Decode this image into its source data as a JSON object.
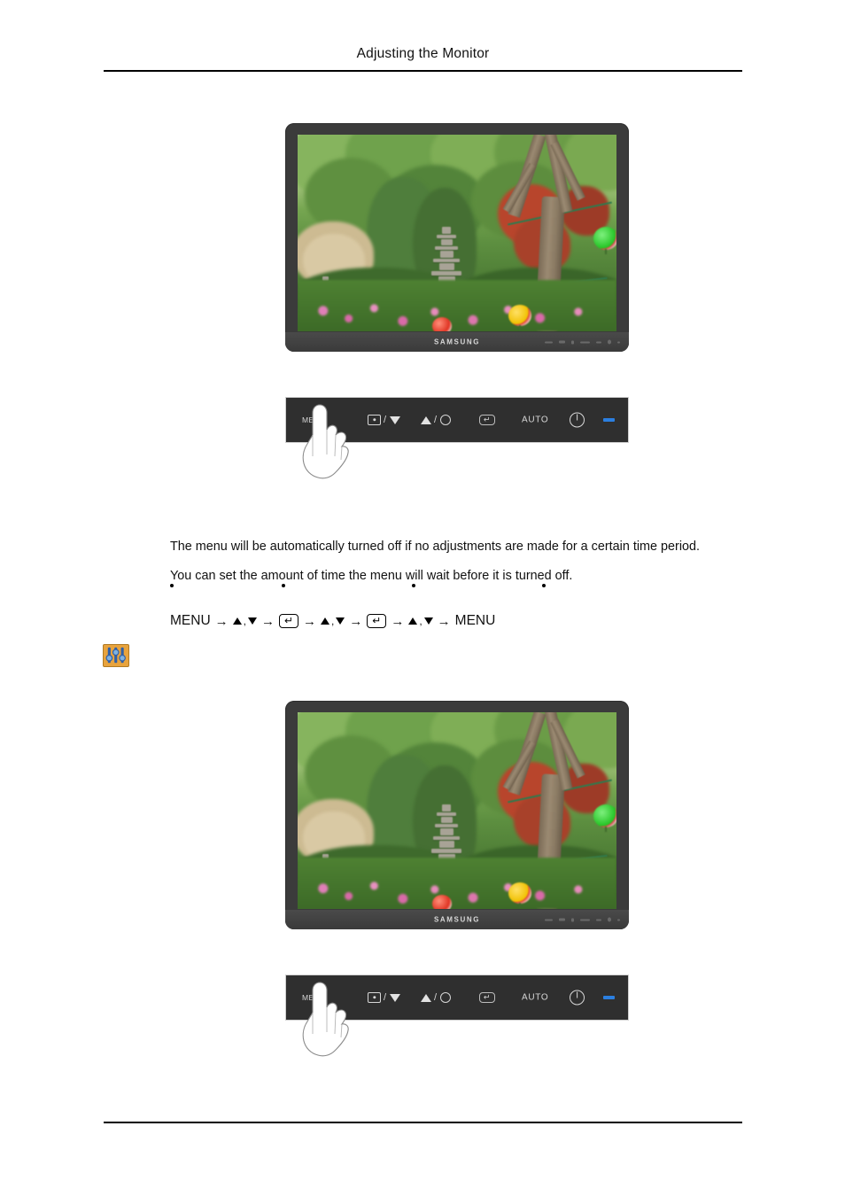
{
  "header": {
    "title": "Adjusting the Monitor"
  },
  "body": {
    "paragraph_1": "The menu will be automatically turned off if no adjustments are made for a certain time period.",
    "paragraph_2": "You can set the amount of time the menu will wait before it is turned off.",
    "bullets": [
      "",
      "",
      "",
      ""
    ]
  },
  "nav_sequence": {
    "start_label": "MENU",
    "end_label": "MENU",
    "arrow": "→",
    "comma": ",",
    "up_icon": "triangle-up-icon",
    "down_icon": "triangle-down-icon",
    "enter_icon": "enter-key-icon"
  },
  "adjust_icon": {
    "name": "sliders-adjust-icon",
    "background": "#e8a33d",
    "slider_color": "#2f5fa8"
  },
  "figures": [
    {
      "id": "figure-top",
      "monitor": {
        "brand": "SAMSUNG",
        "bezel_color": "#3b3b3b",
        "screen_caption": "garden scene with stone pagoda, trees and paper lanterns"
      },
      "control_panel": {
        "buttons": [
          {
            "name": "menu-button",
            "label": "MENU"
          },
          {
            "name": "source-down-button",
            "label": "/",
            "icons": [
              "source-icon",
              "triangle-down-icon"
            ]
          },
          {
            "name": "brightness-up-button",
            "label": "/",
            "icons": [
              "triangle-up-icon",
              "circle-icon"
            ]
          },
          {
            "name": "enter-button",
            "label": "",
            "icons": [
              "enter-key-icon"
            ]
          },
          {
            "name": "auto-button",
            "label": "AUTO"
          },
          {
            "name": "power-button",
            "label": "",
            "icons": [
              "power-icon"
            ]
          },
          {
            "name": "power-led",
            "label": "",
            "color": "#2b7fe0"
          }
        ],
        "hand_overlay": "hand-pressing-menu"
      }
    },
    {
      "id": "figure-bottom",
      "monitor": {
        "brand": "SAMSUNG",
        "bezel_color": "#3b3b3b",
        "screen_caption": "garden scene with stone pagoda, trees and paper lanterns"
      },
      "control_panel": {
        "buttons": [
          {
            "name": "menu-button",
            "label": "MENU"
          },
          {
            "name": "source-down-button",
            "label": "/",
            "icons": [
              "source-icon",
              "triangle-down-icon"
            ]
          },
          {
            "name": "brightness-up-button",
            "label": "/",
            "icons": [
              "triangle-up-icon",
              "circle-icon"
            ]
          },
          {
            "name": "enter-button",
            "label": "",
            "icons": [
              "enter-key-icon"
            ]
          },
          {
            "name": "auto-button",
            "label": "AUTO"
          },
          {
            "name": "power-button",
            "label": "",
            "icons": [
              "power-icon"
            ]
          },
          {
            "name": "power-led",
            "label": "",
            "color": "#2b7fe0"
          }
        ],
        "hand_overlay": "hand-pressing-menu"
      }
    }
  ]
}
